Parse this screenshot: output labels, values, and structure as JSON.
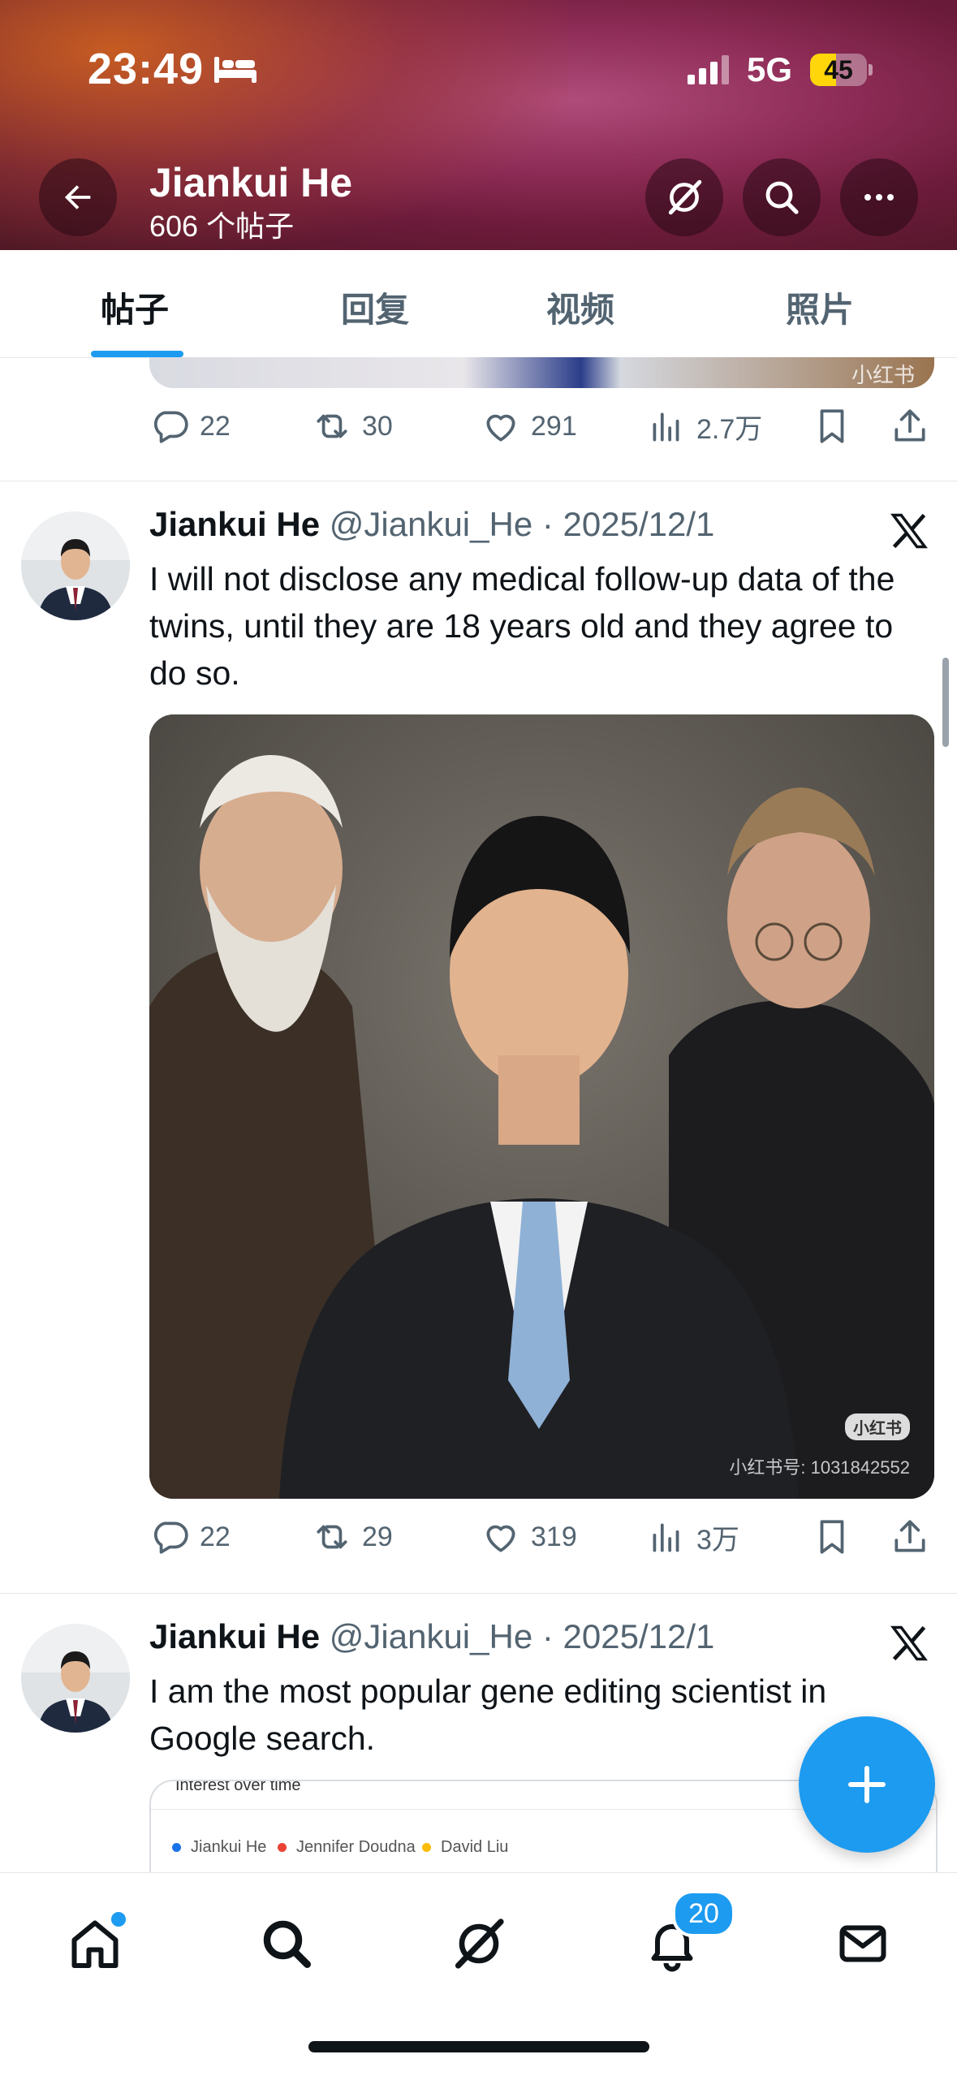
{
  "status_bar": {
    "time": "23:49",
    "network": "5G",
    "battery": "45",
    "battery_level": 0.45
  },
  "header": {
    "profile_name": "Jiankui He",
    "post_count": "606 个帖子"
  },
  "tabs": [
    {
      "label": "帖子"
    },
    {
      "label": "回复"
    },
    {
      "label": "视频"
    },
    {
      "label": "照片"
    }
  ],
  "previous_tweet": {
    "image_watermark": "小红书",
    "stats": {
      "replies": "22",
      "reposts": "30",
      "likes": "291",
      "views": "2.7万"
    }
  },
  "tweets": [
    {
      "author": "Jiankui He",
      "handle": "@Jiankui_He",
      "separator": "·",
      "date": "2025/12/1",
      "text": "I will not disclose any medical follow-up data of the twins, until they are 18 years old and they agree to do so.",
      "image_watermark_logo": "小红书",
      "image_watermark_id": "小红书号: 1031842552",
      "stats": {
        "replies": "22",
        "reposts": "29",
        "likes": "319",
        "views": "3万"
      }
    },
    {
      "author": "Jiankui He",
      "handle": "@Jiankui_He",
      "separator": "·",
      "date": "2025/12/1",
      "text": "I am the most popular gene editing scientist in Google search.",
      "card": {
        "title": "Interest over time",
        "legend": [
          {
            "label": "Jiankui He",
            "color": "#1a73e8"
          },
          {
            "label": "Jennifer Doudna",
            "color": "#ea4335"
          },
          {
            "label": "David Liu",
            "color": "#fbbc04"
          }
        ]
      }
    }
  ],
  "bottom_nav": {
    "notifications_badge": "20"
  },
  "colors": {
    "accent": "#1d9bf0",
    "text": "#0f1419",
    "muted": "#536471"
  }
}
